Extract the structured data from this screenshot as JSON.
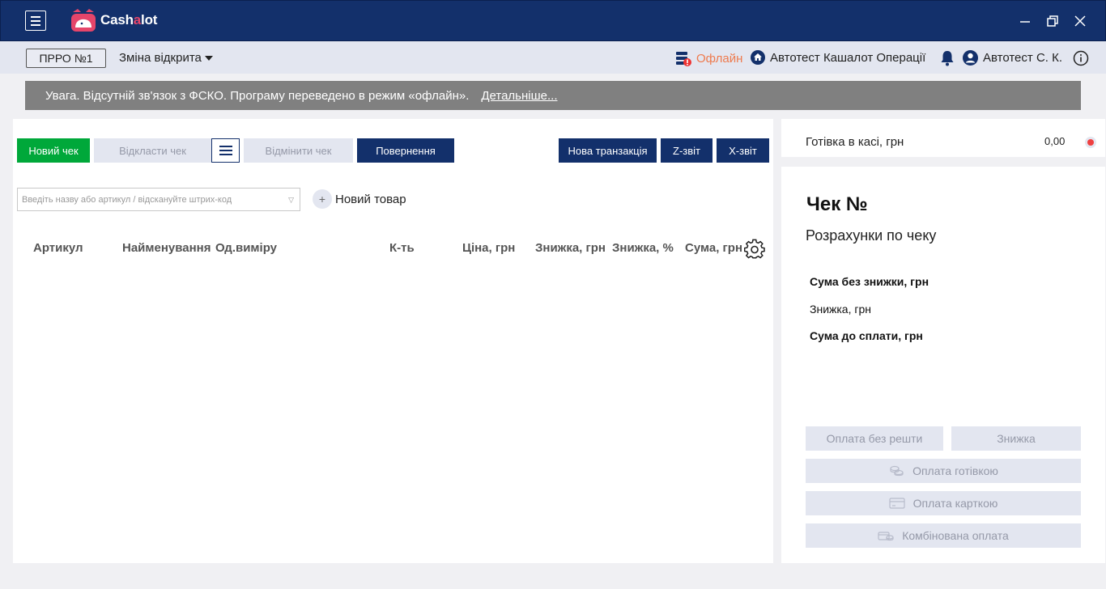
{
  "app": {
    "logo_prefix": "Cash",
    "logo_accent": "a",
    "logo_suffix": "lot"
  },
  "statusbar": {
    "prro_label": "ПРРО №1",
    "shift_label": "Зміна відкрита",
    "offline_label": "Офлайн",
    "org_label": "Автотест Кашалот Операції",
    "user_label": "Автотест С. К."
  },
  "banner": {
    "message": "Увага. Відсутній зв'язок з ФСКО. Програму переведено в режим «офлайн».",
    "link": "Детальніше..."
  },
  "toolbar": {
    "new_check": "Новий чек",
    "postpone_check": "Відкласти чек",
    "cancel_check": "Відмінити чек",
    "return": "Повернення",
    "new_transaction": "Нова транзакція",
    "z_report": "Z-звіт",
    "x_report": "X-звіт"
  },
  "search": {
    "placeholder": "Введіть назву або артикул / відскануйте штрих-код"
  },
  "new_item_label": "Новий товар",
  "table": {
    "columns": [
      "Артикул",
      "Найменування",
      "Од.виміру",
      "К-ть",
      "Ціна, грн",
      "Знижка, грн",
      "Знижка, %",
      "Сума, грн"
    ]
  },
  "cash": {
    "label": "Готівка в касі, грн",
    "value": "0,00"
  },
  "receipt": {
    "title": "Чек №",
    "subtitle": "Розрахунки по чеку",
    "sum_without_discount": "Сума без знижки, грн",
    "discount": "Знижка, грн",
    "sum_to_pay": "Сума до сплати, грн"
  },
  "payments": {
    "no_change": "Оплата без решти",
    "discount": "Знижка",
    "cash": "Оплата готівкою",
    "card": "Оплата карткою",
    "combined": "Комбінована оплата"
  },
  "colors": {
    "titlebar": "#13306b",
    "accent_green": "#00a83a",
    "offline_orange": "#ee7a4d",
    "banner_gray": "#808080"
  }
}
